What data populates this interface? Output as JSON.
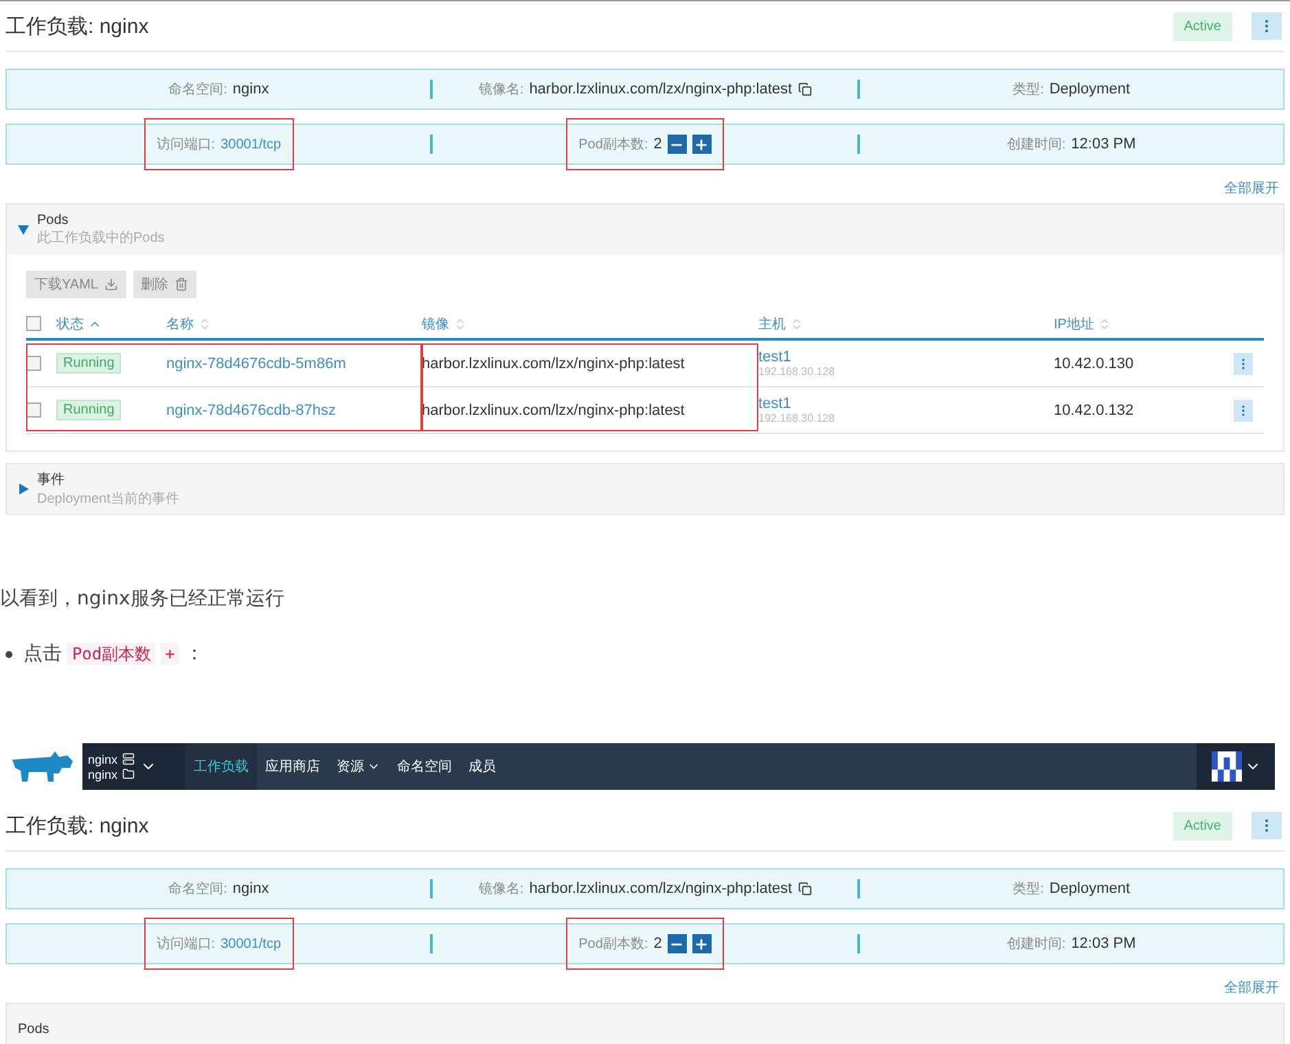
{
  "screenshots": [
    {
      "workload": {
        "title": "工作负载: nginx",
        "status": "Active",
        "info_rows": [
          [
            {
              "label": "命名空间:",
              "value": "nginx",
              "kind": "text",
              "highlighted": false
            },
            {
              "label": "镜像名:",
              "value": "harbor.lzxlinux.com/lzx/nginx-php:latest",
              "kind": "copy",
              "highlighted": false
            },
            {
              "label": "类型:",
              "value": "Deployment",
              "kind": "text",
              "highlighted": false
            }
          ],
          [
            {
              "label": "访问端口:",
              "value": "30001/tcp",
              "kind": "link",
              "highlighted": true
            },
            {
              "label": "Pod副本数:",
              "value": "2",
              "kind": "stepper",
              "highlighted": true
            },
            {
              "label": "创建时间:",
              "value": "12:03 PM",
              "kind": "text",
              "highlighted": false
            }
          ]
        ],
        "expand_all": "全部展开",
        "sections": [
          {
            "title": "Pods",
            "subtitle": "此工作负载中的Pods",
            "expanded": true,
            "toolbar": [
              {
                "label": "下载YAML",
                "kind": "download"
              },
              {
                "label": "删除",
                "kind": "delete"
              }
            ],
            "table": {
              "select_all": false,
              "columns": [
                {
                  "label": "状态",
                  "sorted": true,
                  "highlighted": true
                },
                {
                  "label": "名称",
                  "sorted": false,
                  "highlighted": true
                },
                {
                  "label": "镜像",
                  "sorted": false,
                  "highlighted": false
                },
                {
                  "label": "主机",
                  "sorted": false,
                  "highlighted": false
                },
                {
                  "label": "IP地址",
                  "sorted": false,
                  "highlighted": false
                }
              ],
              "image_highlighted": true,
              "rows": [
                {
                  "checked": false,
                  "status": "Running",
                  "name": "nginx-78d4676cdb-5m86m",
                  "image": "harbor.lzxlinux.com/lzx/nginx-php:latest",
                  "host": "test1",
                  "host_ip": "192.168.30.128",
                  "ip": "10.42.0.130"
                },
                {
                  "checked": false,
                  "status": "Running",
                  "name": "nginx-78d4676cdb-87hsz",
                  "image": "harbor.lzxlinux.com/lzx/nginx-php:latest",
                  "host": "test1",
                  "host_ip": "192.168.30.128",
                  "ip": "10.42.0.132"
                }
              ]
            }
          },
          {
            "title": "事件",
            "subtitle": "Deployment当前的事件",
            "expanded": false
          }
        ]
      }
    },
    {
      "navbar": {
        "cluster": "nginx",
        "project": "nginx",
        "items": [
          {
            "label": "工作负载",
            "selected": true,
            "dropdown": false
          },
          {
            "label": "应用商店",
            "selected": false,
            "dropdown": false
          },
          {
            "label": "资源",
            "selected": false,
            "dropdown": true
          },
          {
            "label": "命名空间",
            "selected": false,
            "dropdown": false
          },
          {
            "label": "成员",
            "selected": false,
            "dropdown": false
          }
        ]
      },
      "workload": {
        "title": "工作负载: nginx",
        "status": "Active",
        "info_rows": [
          [
            {
              "label": "命名空间:",
              "value": "nginx",
              "kind": "text",
              "highlighted": false
            },
            {
              "label": "镜像名:",
              "value": "harbor.lzxlinux.com/lzx/nginx-php:latest",
              "kind": "copy",
              "highlighted": false
            },
            {
              "label": "类型:",
              "value": "Deployment",
              "kind": "text",
              "highlighted": false
            }
          ],
          [
            {
              "label": "访问端口:",
              "value": "30001/tcp",
              "kind": "link",
              "highlighted": true
            },
            {
              "label": "Pod副本数:",
              "value": "2",
              "kind": "stepper",
              "highlighted": true
            },
            {
              "label": "创建时间:",
              "value": "12:03 PM",
              "kind": "text",
              "highlighted": false
            }
          ]
        ],
        "expand_all": "全部展开",
        "sections": [
          {
            "title": "Pods"
          }
        ]
      }
    }
  ],
  "article": {
    "paragraph": "以看到，nginx服务已经正常运行",
    "bullet": [
      {
        "kind": "text",
        "text": "点击 "
      },
      {
        "kind": "code",
        "text": "Pod副本数"
      },
      {
        "kind": "code",
        "text": "+"
      },
      {
        "kind": "text",
        "text": "："
      }
    ]
  }
}
